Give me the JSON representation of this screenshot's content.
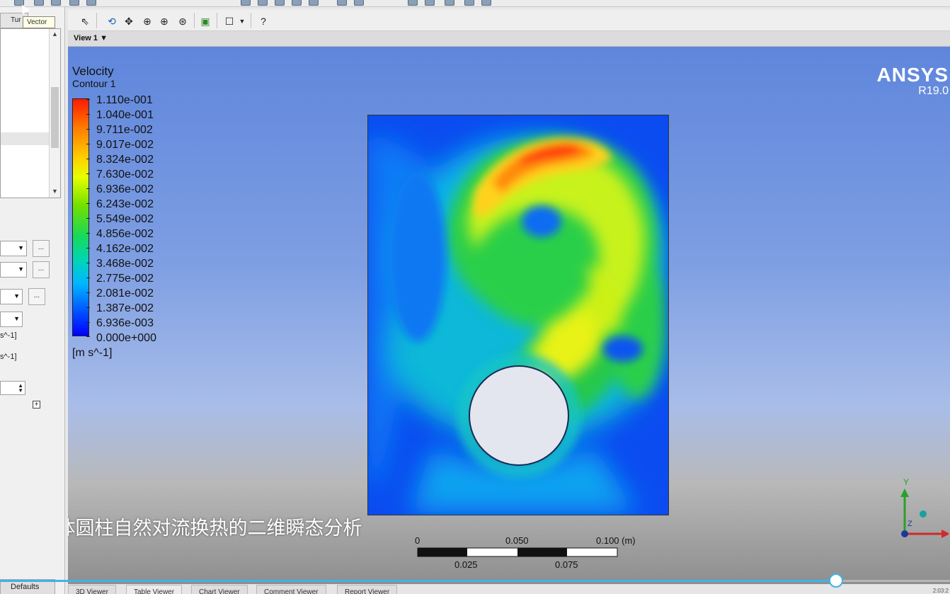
{
  "left_panel": {
    "tab_label": "Tur",
    "tooltip": "Vector",
    "unit_label_1": "s^-1]",
    "unit_label_2": "s^-1]",
    "dots_label": "...",
    "expand_symbol": "+",
    "defaults_tab": "Defaults"
  },
  "view": {
    "label": "View 1"
  },
  "legend": {
    "title": "Velocity",
    "subtitle": "Contour 1",
    "unit": "[m s^-1]",
    "labels": [
      "1.110e-001",
      "1.040e-001",
      "9.711e-002",
      "9.017e-002",
      "8.324e-002",
      "7.630e-002",
      "6.936e-002",
      "6.243e-002",
      "5.549e-002",
      "4.856e-002",
      "4.162e-002",
      "3.468e-002",
      "2.775e-002",
      "2.081e-002",
      "1.387e-002",
      "6.936e-003",
      "0.000e+000"
    ]
  },
  "logo": {
    "brand": "ANSYS",
    "version": "R19.0"
  },
  "scale_bar": {
    "labels_top": [
      "0",
      "0.050",
      "0.100  (m)"
    ],
    "labels_bottom": [
      "0.025",
      "0.075"
    ]
  },
  "triad": {
    "y_label": "Y",
    "z_label": "Z"
  },
  "video": {
    "subtitle": "uent固体圆柱自然对流换热的二维瞬态分析",
    "progress": 0.88,
    "time": "2:03:2"
  },
  "bottom_tabs": [
    "3D Viewer",
    "Table Viewer",
    "Chart Viewer",
    "Comment Viewer",
    "Report Viewer"
  ],
  "icons": {
    "toolbar": [
      "select-icon",
      "rotate-icon",
      "pan-icon",
      "zoom-box-icon",
      "zoom-icon",
      "zoom-fit-icon",
      "fit-view-icon",
      "viewport-layout-icon",
      "help-cursor-icon"
    ]
  },
  "colors": {
    "accent": "#3fb3e6",
    "colormap_high": "#ff1a00",
    "colormap_low": "#0000ff"
  }
}
